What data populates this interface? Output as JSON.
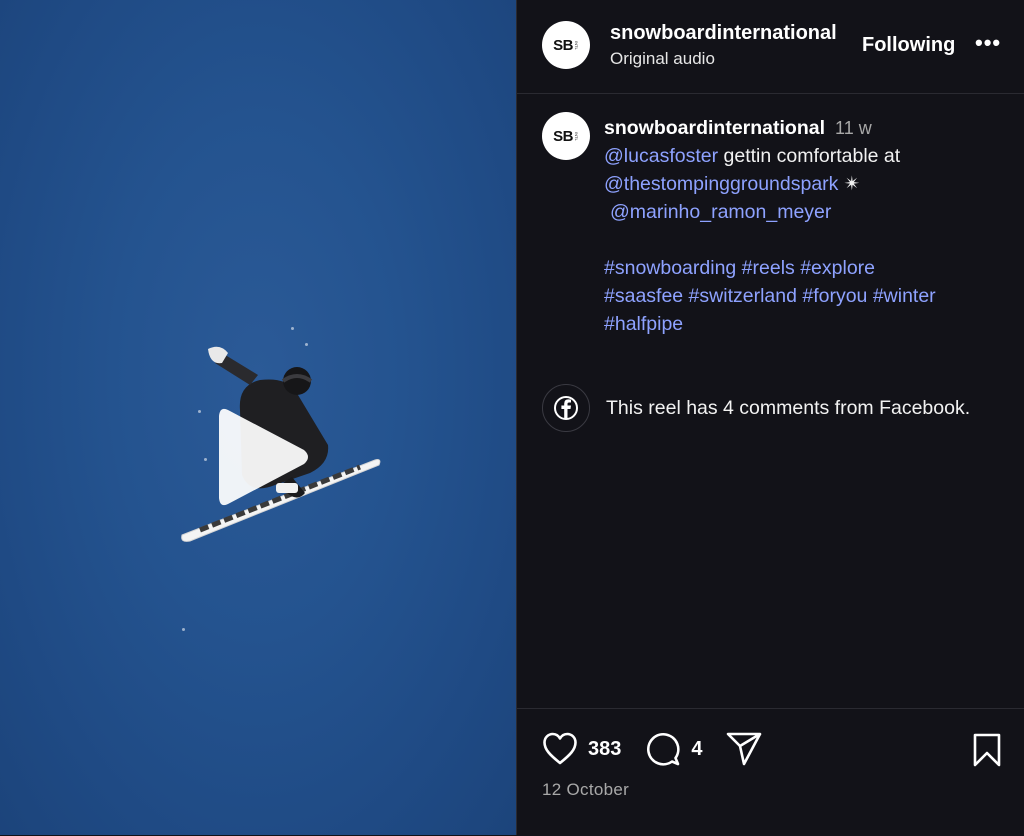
{
  "post": {
    "username": "snowboardinternational",
    "avatar_text": "SB",
    "avatar_small": "INTL",
    "audio": "Original audio",
    "follow_label": "Following",
    "more_label": "•••"
  },
  "caption": {
    "username": "snowboardinternational",
    "time": "11 w",
    "mention_1": "@lucasfoster",
    "text_1": " gettin comfortable at",
    "mention_2": "@thestompinggroundspark",
    "sparkle": " ✴",
    "mention_3": "@marinho_ramon_meyer",
    "hashtags_line_1": "#snowboarding #reels #explore",
    "hashtags_line_2": "#saasfee #switzerland #foryou #winter",
    "hashtags_line_3": "#halfpipe"
  },
  "facebook": {
    "text": "This reel has 4 comments from Facebook.",
    "icon": "facebook-icon"
  },
  "stats": {
    "likes": "383",
    "comments": "4",
    "date": "12 October"
  },
  "icons": {
    "like": "heart-icon",
    "comment": "comment-bubble-icon",
    "share": "send-icon",
    "save": "bookmark-icon",
    "play": "play-icon"
  },
  "colors": {
    "background": "#121218",
    "link": "#8ea2ff",
    "sky": "#24538f"
  }
}
